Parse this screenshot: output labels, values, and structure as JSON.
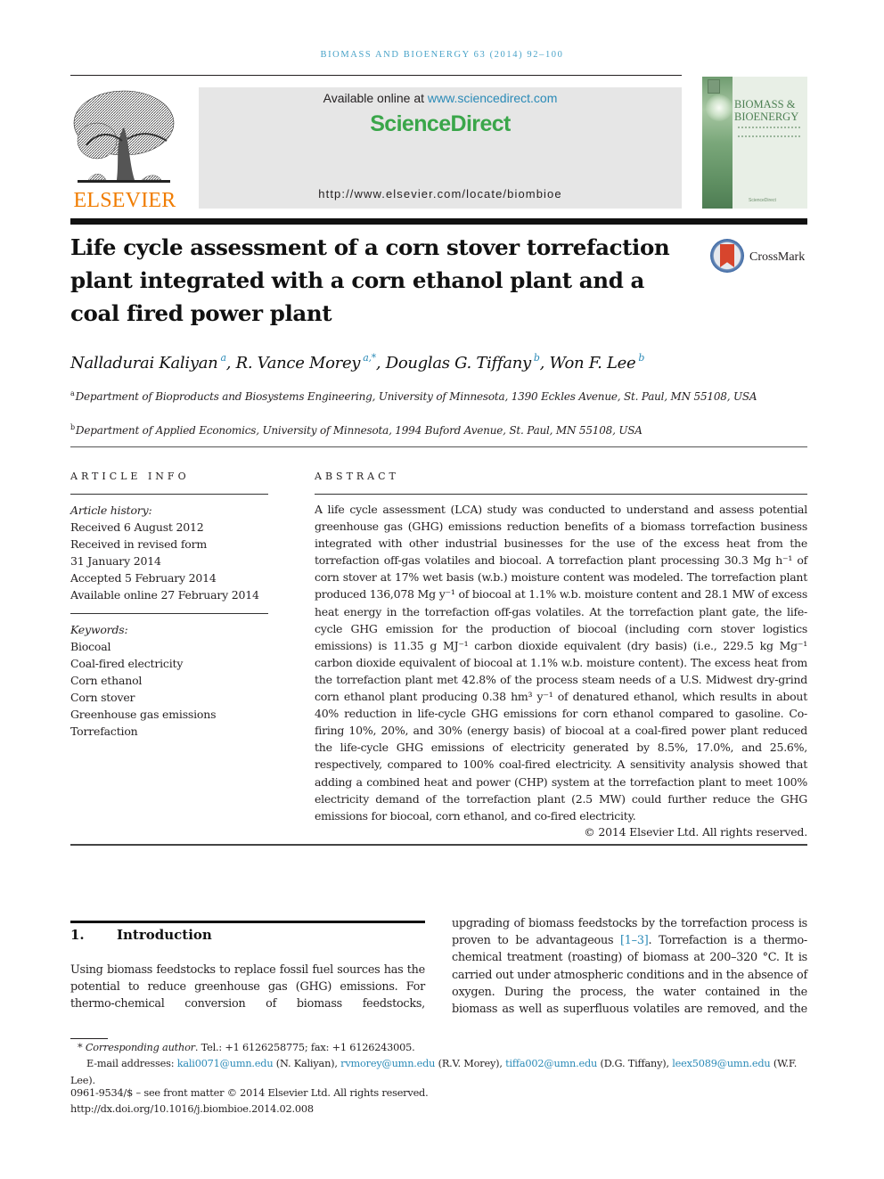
{
  "journal": {
    "running_head": "BIOMASS AND BIOENERGY 63 (2014) 92–100",
    "publisher_logo_text": "ELSEVIER",
    "available_online_prefix": "Available online at ",
    "available_online_link": "www.sciencedirect.com",
    "sciencedirect_brand": "ScienceDirect",
    "journal_url": "http://www.elsevier.com/locate/biombioe",
    "cover_title_line1": "BIOMASS &",
    "cover_title_line2": "BIOENERGY",
    "cover_footer": "ScienceDirect",
    "crossmark_label": "CrossMark",
    "colors": {
      "link": "#2a8ab7",
      "elsevier_orange": "#f07c00",
      "sciencedirect_green": "#3aa64a",
      "running_head": "#4aa3c8"
    }
  },
  "article": {
    "title": "Life cycle assessment of a corn stover torrefaction plant integrated with a corn ethanol plant and a coal fired power plant",
    "authors": [
      {
        "name": "Nalladurai Kaliyan",
        "aff": "a"
      },
      {
        "name": "R. Vance Morey",
        "aff": "a,*"
      },
      {
        "name": "Douglas G. Tiffany",
        "aff": "b"
      },
      {
        "name": "Won F. Lee",
        "aff": "b"
      }
    ],
    "affiliations": [
      {
        "mark": "a",
        "text": "Department of Bioproducts and Biosystems Engineering, University of Minnesota, 1390 Eckles Avenue, St. Paul, MN 55108, USA"
      },
      {
        "mark": "b",
        "text": "Department of Applied Economics, University of Minnesota, 1994 Buford Avenue, St. Paul, MN 55108, USA"
      }
    ]
  },
  "article_info": {
    "heading": "ARTICLE INFO",
    "history_label": "Article history:",
    "history": [
      "Received 6 August 2012",
      "Received in revised form",
      "31 January 2014",
      "Accepted 5 February 2014",
      "Available online 27 February 2014"
    ],
    "keywords_label": "Keywords:",
    "keywords": [
      "Biocoal",
      "Coal-fired electricity",
      "Corn ethanol",
      "Corn stover",
      "Greenhouse gas emissions",
      "Torrefaction"
    ]
  },
  "abstract": {
    "heading": "ABSTRACT",
    "text": "A life cycle assessment (LCA) study was conducted to understand and assess potential greenhouse gas (GHG) emissions reduction benefits of a biomass torrefaction business integrated with other industrial businesses for the use of the excess heat from the torrefaction off-gas volatiles and biocoal. A torrefaction plant processing 30.3 Mg h⁻¹ of corn stover at 17% wet basis (w.b.) moisture content was modeled. The torrefaction plant produced 136,078 Mg y⁻¹ of biocoal at 1.1% w.b. moisture content and 28.1 MW of excess heat energy in the torrefaction off-gas volatiles. At the torrefaction plant gate, the life-cycle GHG emission for the production of biocoal (including corn stover logistics emissions) is 11.35 g MJ⁻¹ carbon dioxide equivalent (dry basis) (i.e., 229.5 kg Mg⁻¹ carbon dioxide equivalent of biocoal at 1.1% w.b. moisture content). The excess heat from the torrefaction plant met 42.8% of the process steam needs of a U.S. Midwest dry-grind corn ethanol plant producing 0.38 hm³ y⁻¹ of denatured ethanol, which results in about 40% reduction in life-cycle GHG emissions for corn ethanol compared to gasoline. Co-firing 10%, 20%, and 30% (energy basis) of biocoal at a coal-fired power plant reduced the life-cycle GHG emissions of electricity generated by 8.5%, 17.0%, and 25.6%, respectively, compared to 100% coal-fired electricity. A sensitivity analysis showed that adding a combined heat and power (CHP) system at the torrefaction plant to meet 100% electricity demand of the torrefaction plant (2.5 MW) could further reduce the GHG emissions for biocoal, corn ethanol, and co-fired electricity.",
    "copyright": "© 2014 Elsevier Ltd. All rights reserved."
  },
  "introduction": {
    "number": "1.",
    "heading": "Introduction",
    "left_text": "Using biomass feedstocks to replace fossil fuel sources has the potential to reduce greenhouse gas (GHG) emissions. For thermo-chemical conversion of biomass feedstocks,",
    "right_text_before_ref": "upgrading of biomass feedstocks by the torrefaction process is proven to be advantageous ",
    "right_ref": "[1–3]",
    "right_text_after_ref": ". Torrefaction is a thermo-chemical treatment (roasting) of biomass at 200–320 °C. It is carried out under atmospheric conditions and in the absence of oxygen. During the process, the water contained in the biomass as well as superfluous volatiles are removed, and the"
  },
  "footnotes": {
    "corresponding_mark": "*",
    "corresponding_label": "Corresponding author",
    "corresponding_text": ". Tel.: +1 6126258775; fax: +1 6126243005.",
    "email_label": "E-mail addresses: ",
    "emails": [
      {
        "address": "kali0071@umn.edu",
        "who": " (N. Kaliyan), "
      },
      {
        "address": "rvmorey@umn.edu",
        "who": " (R.V. Morey), "
      },
      {
        "address": "tiffa002@umn.edu",
        "who": " (D.G. Tiffany), "
      },
      {
        "address": "leex5089@umn.edu",
        "who": " (W.F. Lee)."
      }
    ],
    "front_matter": "0961-9534/$ – see front matter © 2014 Elsevier Ltd. All rights reserved.",
    "doi": "http://dx.doi.org/10.1016/j.biombioe.2014.02.008"
  }
}
